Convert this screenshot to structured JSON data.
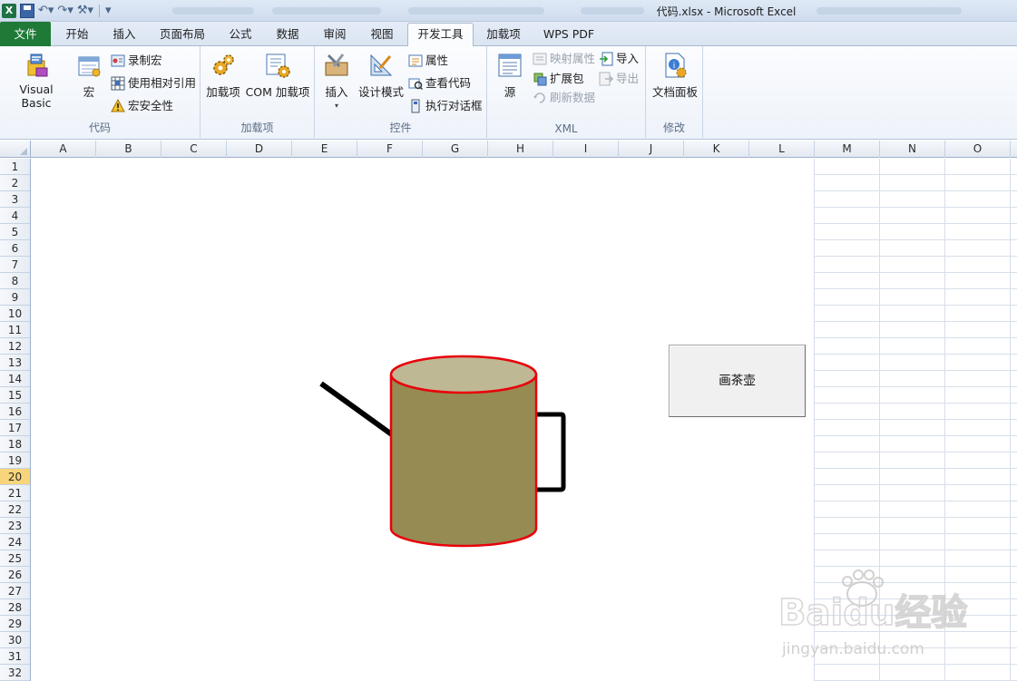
{
  "window": {
    "title": "代码.xlsx  -  Microsoft Excel"
  },
  "quick_access": {
    "icons": [
      "excel-logo-icon",
      "save-icon",
      "undo-icon",
      "redo-icon",
      "customize-icon"
    ]
  },
  "tabs": [
    {
      "label": "文件",
      "state": "file"
    },
    {
      "label": "开始",
      "state": "normal"
    },
    {
      "label": "插入",
      "state": "normal"
    },
    {
      "label": "页面布局",
      "state": "normal"
    },
    {
      "label": "公式",
      "state": "normal"
    },
    {
      "label": "数据",
      "state": "normal"
    },
    {
      "label": "审阅",
      "state": "normal"
    },
    {
      "label": "视图",
      "state": "normal"
    },
    {
      "label": "开发工具",
      "state": "active"
    },
    {
      "label": "加载项",
      "state": "normal"
    },
    {
      "label": "WPS PDF",
      "state": "normal"
    }
  ],
  "ribbon": {
    "code": {
      "label": "代码",
      "visual_basic": "Visual Basic",
      "macros": "宏",
      "record_macro": "录制宏",
      "relative_refs": "使用相对引用",
      "macro_security": "宏安全性"
    },
    "addins": {
      "label": "加载项",
      "addins": "加载项",
      "com_addins": "COM 加载项"
    },
    "controls": {
      "label": "控件",
      "insert": "插入",
      "design_mode": "设计模式",
      "properties": "属性",
      "view_code": "查看代码",
      "run_dialog": "执行对话框"
    },
    "xml": {
      "label": "XML",
      "source": "源",
      "map_properties": "映射属性",
      "expansion_packs": "扩展包",
      "refresh_data": "刷新数据",
      "import": "导入",
      "export": "导出"
    },
    "modify": {
      "label": "修改",
      "document_panel": "文档面板"
    }
  },
  "sheet": {
    "columns": [
      "A",
      "B",
      "C",
      "D",
      "E",
      "F",
      "G",
      "H",
      "I",
      "J",
      "K",
      "L",
      "M",
      "N",
      "O"
    ],
    "rows": [
      "1",
      "2",
      "3",
      "4",
      "5",
      "6",
      "7",
      "8",
      "9",
      "10",
      "11",
      "12",
      "13",
      "14",
      "15",
      "16",
      "17",
      "18",
      "19",
      "20",
      "21",
      "22",
      "23",
      "24",
      "25",
      "26",
      "27",
      "28",
      "29",
      "30",
      "31",
      "32"
    ],
    "selected_row": "20"
  },
  "macro_button": {
    "label": "画茶壶"
  },
  "drawing": {
    "body_fill": "#968b52",
    "top_fill": "#bfb894",
    "outline": "#e8000b",
    "spout_color": "#000000",
    "handle_color": "#000000"
  },
  "watermark": {
    "brand": "Baidu经验",
    "url": "jingyan.baidu.com"
  }
}
